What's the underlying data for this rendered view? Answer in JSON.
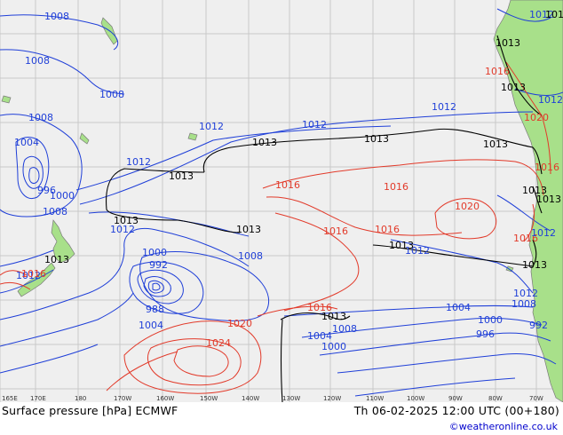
{
  "map": {
    "title": "Surface pressure [hPa] ECMWF",
    "valid_time": "Th 06-02-2025 12:00 UTC (00+180)",
    "credit": "©weatheronline.co.uk",
    "colors": {
      "ocean": "#efefef",
      "land": "#a8e08a",
      "grid": "#c8c8c8",
      "low_isobar": "#1f3fd8",
      "high_isobar": "#e23a2a",
      "standard_isobar": "#000000",
      "credit": "#0000cc"
    },
    "longitude_ticks": [
      "165E",
      "170E",
      "180",
      "170W",
      "160W",
      "150W",
      "140W",
      "130W",
      "120W",
      "110W",
      "100W",
      "90W",
      "80W",
      "70W"
    ],
    "isobar_labels": [
      {
        "text": "1008",
        "color": "blue"
      },
      {
        "text": "1008",
        "color": "blue"
      },
      {
        "text": "1008",
        "color": "blue"
      },
      {
        "text": "1008",
        "color": "blue"
      },
      {
        "text": "1004",
        "color": "blue"
      },
      {
        "text": "1000",
        "color": "blue"
      },
      {
        "text": "996",
        "color": "blue"
      },
      {
        "text": "1008",
        "color": "blue"
      },
      {
        "text": "1012",
        "color": "blue"
      },
      {
        "text": "1012",
        "color": "blue"
      },
      {
        "text": "1012",
        "color": "blue"
      },
      {
        "text": "1012",
        "color": "blue"
      },
      {
        "text": "1012",
        "color": "blue"
      },
      {
        "text": "1013",
        "color": "black"
      },
      {
        "text": "1013",
        "color": "black"
      },
      {
        "text": "1013",
        "color": "black"
      },
      {
        "text": "1013",
        "color": "black"
      },
      {
        "text": "1013",
        "color": "black"
      },
      {
        "text": "1013",
        "color": "black"
      },
      {
        "text": "1013",
        "color": "black"
      },
      {
        "text": "1013",
        "color": "black"
      },
      {
        "text": "1016",
        "color": "red"
      },
      {
        "text": "1016",
        "color": "red"
      },
      {
        "text": "1016",
        "color": "red"
      },
      {
        "text": "1016",
        "color": "red"
      },
      {
        "text": "1020",
        "color": "red"
      },
      {
        "text": "1000",
        "color": "blue"
      },
      {
        "text": "992",
        "color": "blue"
      },
      {
        "text": "988",
        "color": "blue"
      },
      {
        "text": "1004",
        "color": "blue"
      },
      {
        "text": "1008",
        "color": "blue"
      },
      {
        "text": "1012",
        "color": "blue"
      },
      {
        "text": "1016",
        "color": "red"
      },
      {
        "text": "1020",
        "color": "red"
      },
      {
        "text": "1024",
        "color": "red"
      },
      {
        "text": "1016",
        "color": "red"
      },
      {
        "text": "1013",
        "color": "black"
      },
      {
        "text": "1008",
        "color": "blue"
      },
      {
        "text": "1004",
        "color": "blue"
      },
      {
        "text": "1000",
        "color": "blue"
      },
      {
        "text": "1004",
        "color": "blue"
      },
      {
        "text": "1000",
        "color": "blue"
      },
      {
        "text": "996",
        "color": "blue"
      },
      {
        "text": "992",
        "color": "blue"
      },
      {
        "text": "1008",
        "color": "blue"
      },
      {
        "text": "1012",
        "color": "blue"
      },
      {
        "text": "1013",
        "color": "black"
      },
      {
        "text": "1012",
        "color": "blue"
      },
      {
        "text": "1016",
        "color": "red"
      },
      {
        "text": "1012",
        "color": "blue"
      },
      {
        "text": "1013",
        "color": "black"
      },
      {
        "text": "1012",
        "color": "blue"
      },
      {
        "text": "1016",
        "color": "red"
      },
      {
        "text": "1020",
        "color": "red"
      },
      {
        "text": "1016",
        "color": "red"
      },
      {
        "text": "1013",
        "color": "black"
      },
      {
        "text": "1013",
        "color": "black"
      },
      {
        "text": "1013",
        "color": "black"
      },
      {
        "text": "1012",
        "color": "blue"
      },
      {
        "text": "1013",
        "color": "black"
      }
    ]
  }
}
